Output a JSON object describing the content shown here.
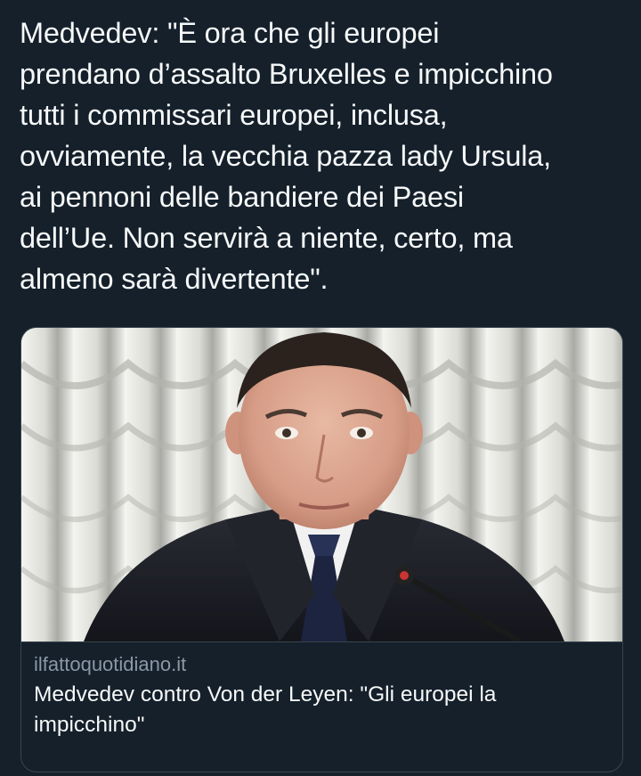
{
  "tweet": {
    "text_lines": [
      "Medvedev: \"È ora che gli europei",
      "prendano d’assalto Bruxelles e impicchino",
      "tutti i commissari europei, inclusa,",
      "ovviamente, la vecchia pazza lady Ursula,",
      "ai pennoni delle bandiere dei Paesi",
      "dell’Ue. Non servirà a niente, certo, ma",
      "almeno sarà divertente\"."
    ]
  },
  "card": {
    "domain": "ilfattoquotidiano.it",
    "title": "Medvedev contro Von der Leyen: \"Gli europei la impicchino\""
  },
  "colors": {
    "background": "#15202b",
    "text": "#f7f9f9",
    "muted": "#8b98a5",
    "border": "#38444d"
  }
}
